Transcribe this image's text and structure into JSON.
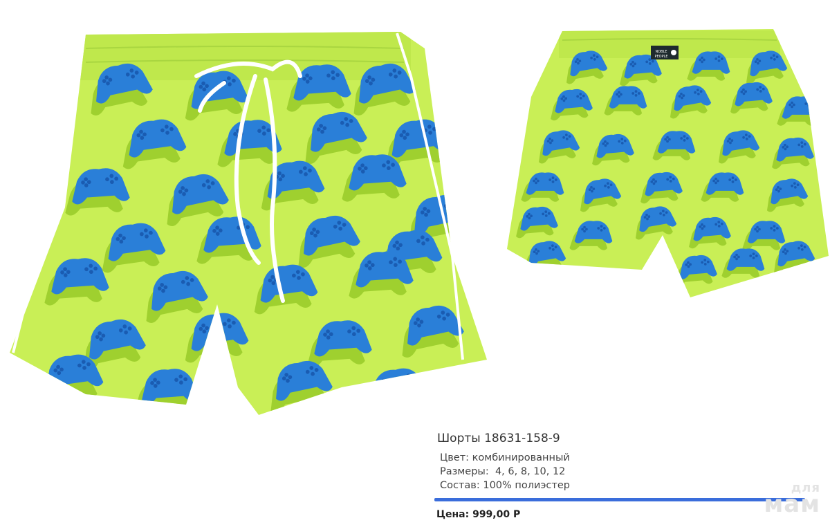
{
  "product": {
    "title": "Шорты 18631-158-9",
    "color": "Цвет: комбинированный",
    "sizes": "Размеры:  4, 6, 8, 10, 12",
    "composition": "Состав: 100% полиэстер",
    "price": "Цена: 999,00 Р"
  },
  "watermark": {
    "top": "для",
    "bottom": "мам"
  },
  "label_text": "NOBLE PEOPLE",
  "colors": {
    "fabric": "#c9ef56",
    "fabric_shadow": "#9fd02f",
    "controller": "#2a7fd8",
    "controller_dark": "#1a5cb2",
    "accent_bar": "#3a6ddb"
  }
}
